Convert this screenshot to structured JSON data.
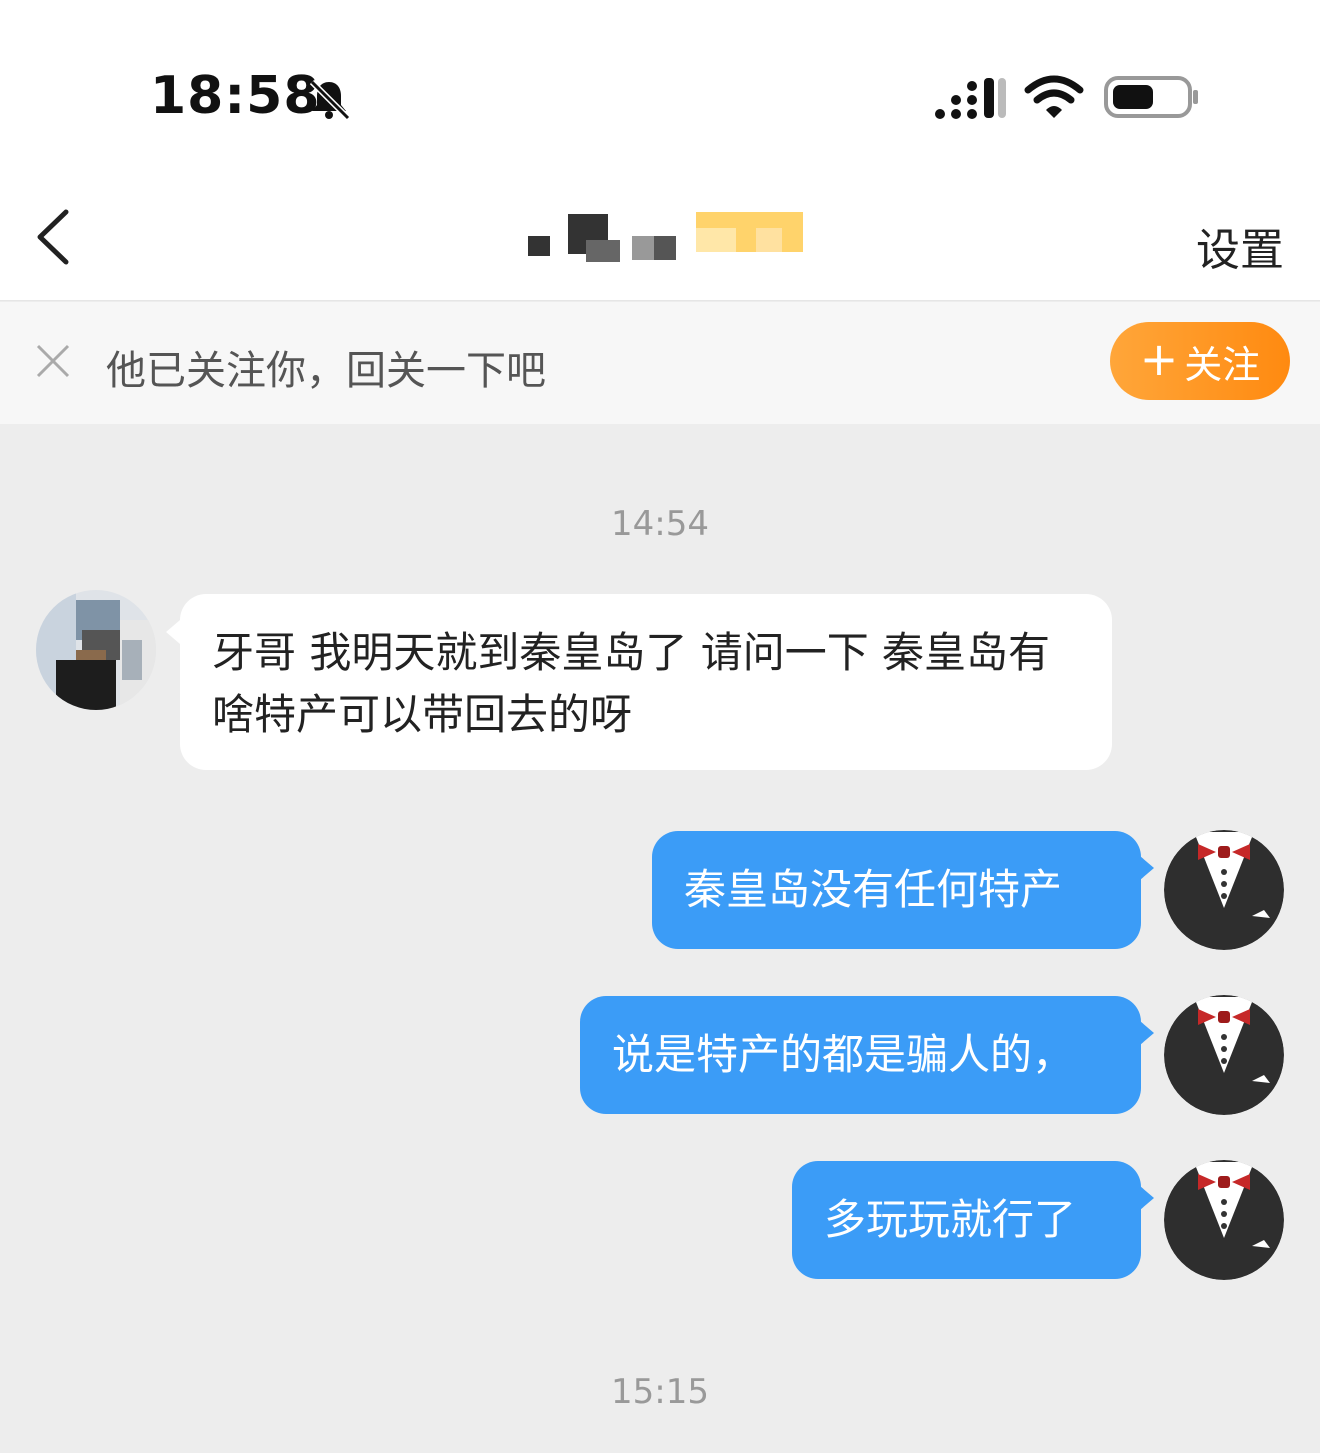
{
  "status_bar": {
    "time": "18:58",
    "icons": [
      "bell-muted-icon",
      "signal-icon",
      "wifi-icon",
      "battery-icon"
    ]
  },
  "nav": {
    "back_icon": "chevron-left-icon",
    "settings_label": "设置"
  },
  "follow_prompt": {
    "text": "他已关注你，回关一下吧",
    "button_label": "关注",
    "button_plus": "+",
    "close_icon": "close-icon"
  },
  "messages": {
    "timestamp_1": "14:54",
    "incoming_1": "牙哥 我明天就到秦皇岛了 请问一下 秦皇岛有啥特产可以带回去的呀",
    "outgoing_1": "秦皇岛没有任何特产",
    "outgoing_2": "说是特产的都是骗人的，",
    "outgoing_3": "多玩玩就行了",
    "timestamp_2": "15:15"
  },
  "colors": {
    "accent_orange": "#ff8a10",
    "outgoing_bubble": "#3b9cf7",
    "chat_background": "#ededed"
  }
}
